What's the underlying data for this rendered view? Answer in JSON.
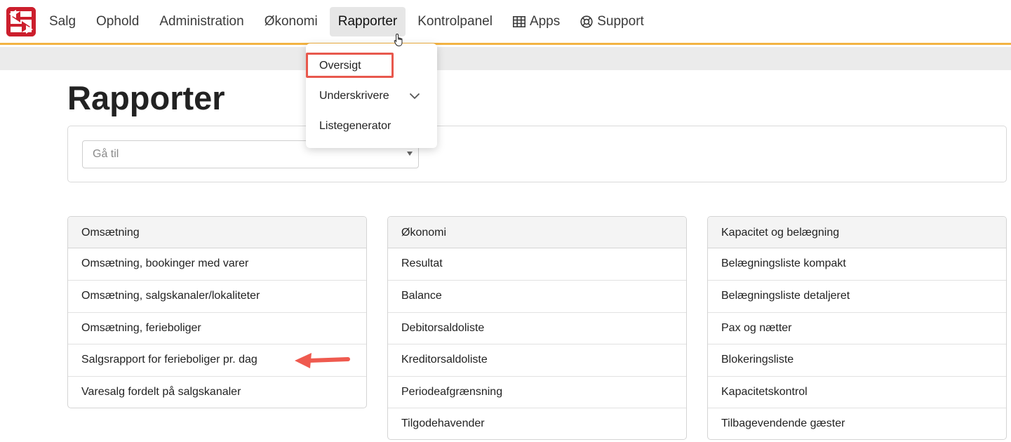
{
  "nav": {
    "items": [
      {
        "label": "Salg"
      },
      {
        "label": "Ophold"
      },
      {
        "label": "Administration"
      },
      {
        "label": "Økonomi"
      },
      {
        "label": "Rapporter",
        "active": true
      },
      {
        "label": "Kontrolpanel"
      },
      {
        "label": "Apps",
        "icon": "grid-icon"
      },
      {
        "label": "Support",
        "icon": "lifebuoy-icon"
      }
    ]
  },
  "dropdown": {
    "items": [
      "Oversigt",
      "Underskrivere",
      "Listegenerator"
    ]
  },
  "page": {
    "title": "Rapporter",
    "goto_placeholder": "Gå til"
  },
  "cards": [
    {
      "header": "Omsætning",
      "rows": [
        "Omsætning, bookinger med varer",
        "Omsætning, salgskanaler/lokaliteter",
        "Omsætning, ferieboliger",
        "Salgsrapport for ferieboliger pr. dag",
        "Varesalg fordelt på salgskanaler"
      ]
    },
    {
      "header": "Økonomi",
      "rows": [
        "Resultat",
        "Balance",
        "Debitorsaldoliste",
        "Kreditorsaldoliste",
        "Periodeafgrænsning",
        "Tilgodehavender"
      ]
    },
    {
      "header": "Kapacitet og belægning",
      "rows": [
        "Belægningsliste kompakt",
        "Belægningsliste detaljeret",
        "Pax og nætter",
        "Blokeringsliste",
        "Kapacitetskontrol",
        "Tilbagevendende gæster"
      ]
    }
  ],
  "colors": {
    "accent": "#f3b343",
    "brand": "#cc1f2d",
    "highlight": "#e8584d"
  }
}
